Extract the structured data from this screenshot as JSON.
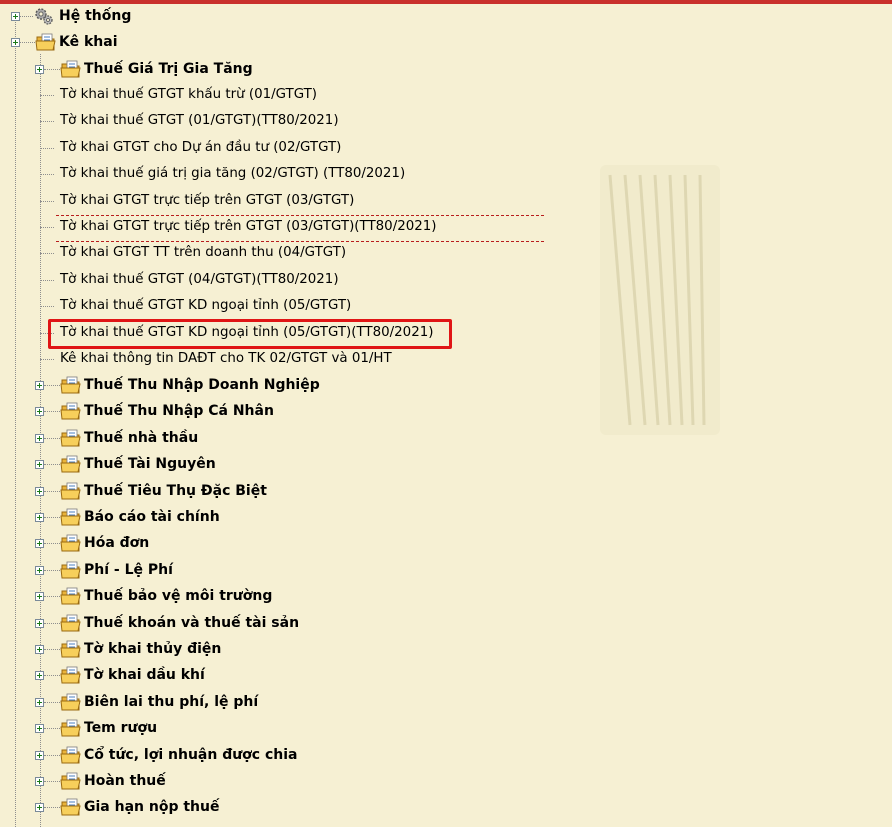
{
  "tree": {
    "root_items": [
      {
        "id": "he-thong",
        "label": "Hệ thống",
        "icon": "gears-icon",
        "expanded": false
      },
      {
        "id": "ke-khai",
        "label": "Kê khai",
        "icon": "folder-icon",
        "expanded": true
      }
    ],
    "vat_group": {
      "label": "Thuế Giá Trị Gia Tăng",
      "icon": "folder-icon",
      "forms": [
        "Tờ khai thuế GTGT khấu trừ (01/GTGT)",
        "Tờ khai thuế GTGT (01/GTGT)(TT80/2021)",
        "Tờ khai GTGT cho Dự án đầu tư (02/GTGT)",
        "Tờ khai thuế giá trị gia tăng (02/GTGT) (TT80/2021)",
        "Tờ khai GTGT trực tiếp trên GTGT (03/GTGT)",
        "Tờ khai GTGT trực tiếp trên GTGT (03/GTGT)(TT80/2021)",
        "Tờ khai GTGT TT trên doanh thu (04/GTGT)",
        "Tờ khai thuế GTGT (04/GTGT)(TT80/2021)",
        "Tờ khai thuế GTGT KD ngoại tỉnh (05/GTGT)",
        "Tờ khai thuế GTGT KD ngoại tỉnh (05/GTGT)(TT80/2021)",
        "Kê khai thông tin DAĐT cho TK 02/GTGT và 01/HT"
      ],
      "focused_index": 5,
      "highlighted_index": 9
    },
    "groups": [
      "Thuế Thu Nhập Doanh Nghiệp",
      "Thuế Thu Nhập Cá Nhân",
      "Thuế nhà thầu",
      "Thuế Tài Nguyên",
      "Thuế Tiêu Thụ Đặc Biệt",
      "Báo cáo tài chính",
      "Hóa đơn",
      "Phí - Lệ Phí",
      "Thuế bảo vệ môi trường",
      "Thuế khoán và thuế tài sản",
      "Tờ khai thủy điện",
      "Tờ khai dầu khí",
      "Biên lai thu phí, lệ phí",
      "Tem rượu",
      "Cổ tức, lợi nhuận được chia",
      "Hoàn thuế",
      "Gia hạn nộp thuế"
    ]
  },
  "colors": {
    "background": "#f6f0d3",
    "highlight": "#e01515",
    "focus_dash": "#b81d1d",
    "top_bar": "#c9302c"
  }
}
